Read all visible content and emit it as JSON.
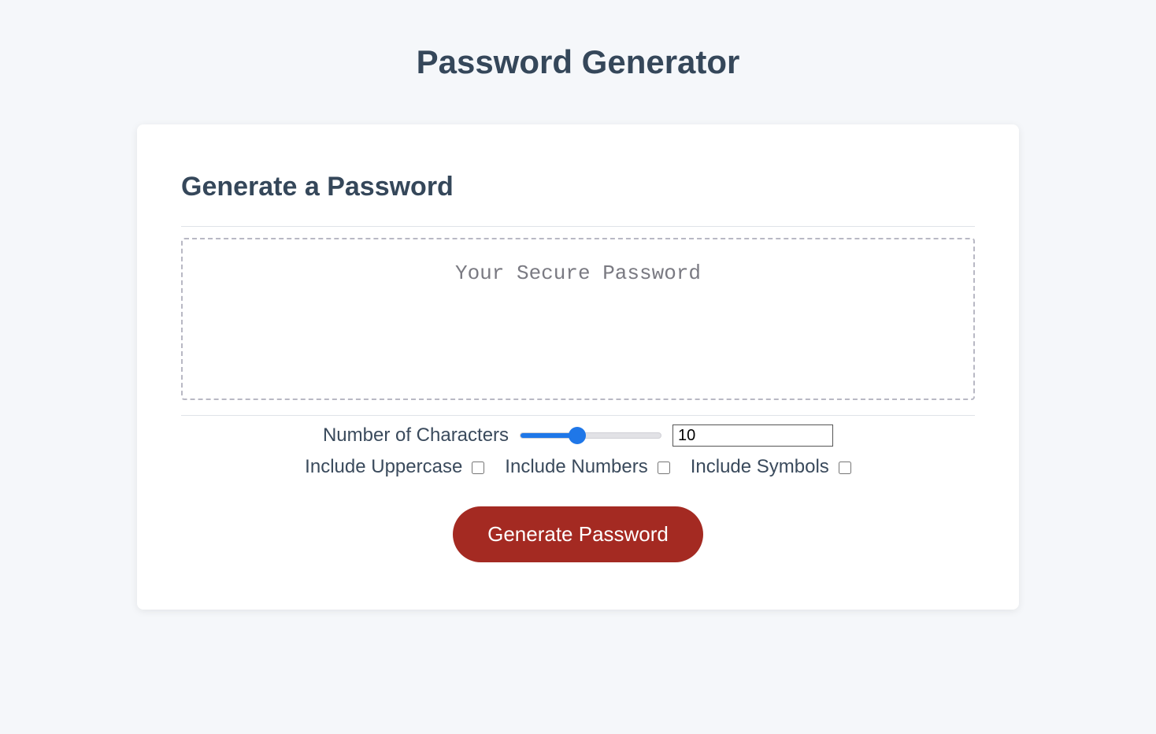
{
  "header": {
    "page_title": "Password Generator"
  },
  "card": {
    "title": "Generate a Password",
    "output_placeholder": "Your Secure Password",
    "output_value": ""
  },
  "controls": {
    "characters_label": "Number of Characters",
    "characters_value": "10",
    "slider_min": "1",
    "slider_max": "24",
    "uppercase_label": "Include Uppercase",
    "uppercase_checked": false,
    "numbers_label": "Include Numbers",
    "numbers_checked": false,
    "symbols_label": "Include Symbols",
    "symbols_checked": false
  },
  "actions": {
    "generate_label": "Generate Password"
  }
}
